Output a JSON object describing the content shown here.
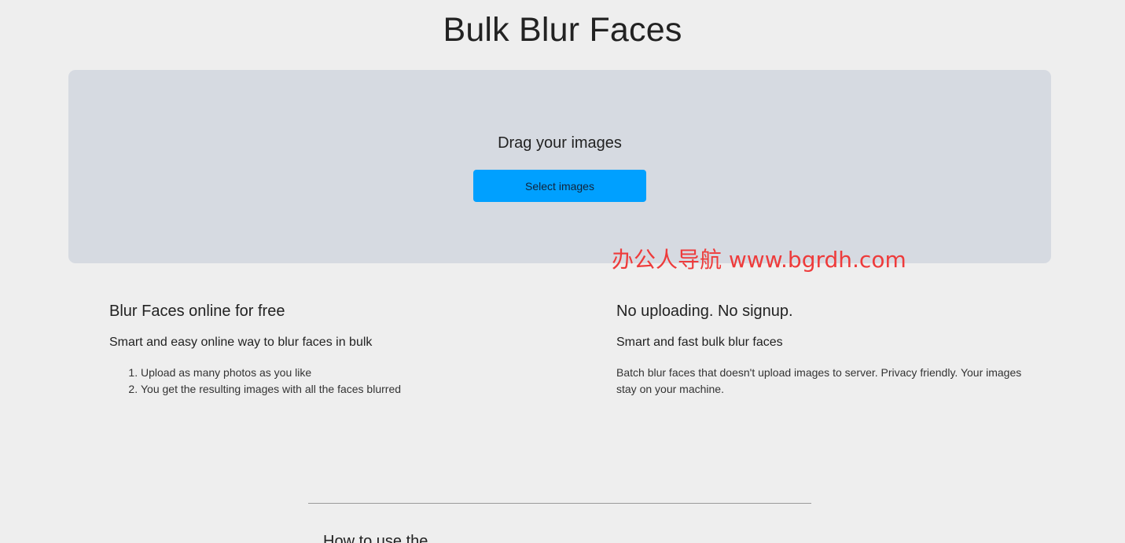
{
  "header": {
    "title": "Bulk Blur Faces"
  },
  "dropzone": {
    "prompt": "Drag your images",
    "button_label": "Select images"
  },
  "watermark": {
    "text": "办公人导航  www.bgrdh.com"
  },
  "features": {
    "left": {
      "heading": "Blur Faces online for free",
      "subheading": "Smart and easy online way to blur faces in bulk",
      "steps": [
        "Upload as many photos as you like",
        "You get the resulting images with all the faces blurred"
      ]
    },
    "right": {
      "heading": "No uploading. No signup.",
      "subheading": "Smart and fast bulk blur faces",
      "body": "Batch blur faces that doesn't upload images to server. Privacy friendly. Your images stay on your machine."
    }
  },
  "next_section": {
    "heading": "How to use the..."
  },
  "colors": {
    "background": "#eeeeee",
    "dropzone_bg": "#d6dae1",
    "button_bg": "#00a0ff",
    "watermark": "#ee3b3b"
  }
}
